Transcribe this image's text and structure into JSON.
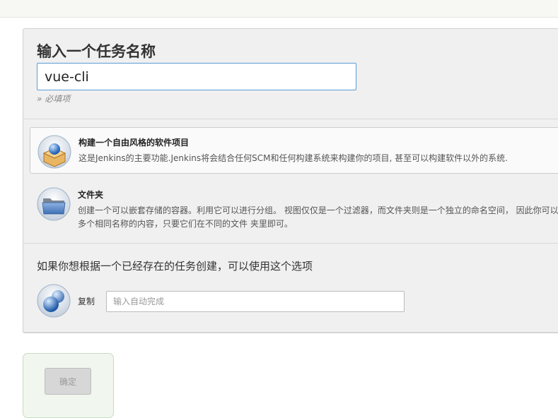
{
  "form": {
    "name_title": "输入一个任务名称",
    "name_value": "vue-cli",
    "required_note": "» 必填项"
  },
  "item_types": [
    {
      "label": "构建一个自由风格的软件项目",
      "description": "这是Jenkins的主要功能.Jenkins将会结合任何SCM和任何构建系统来构建你的项目, 甚至可以构建软件以外的系统.",
      "icon": "freestyle-project-icon",
      "selected": true
    },
    {
      "label": "文件夹",
      "description": "创建一个可以嵌套存储的容器。利用它可以进行分组。 视图仅仅是一个过滤器，而文件夹则是一个独立的命名空间， 因此你可以有多个相同名称的内容，只要它们在不同的文件 夹里即可。",
      "icon": "folder-icon",
      "selected": false
    }
  ],
  "copy": {
    "hint": "如果你想根据一个已经存在的任务创建，可以使用这个选项",
    "label": "复制",
    "placeholder": "输入自动完成",
    "icon": "copy-icon"
  },
  "footer": {
    "ok_label": "确定",
    "ok_enabled": false
  },
  "colors": {
    "input_focus_border": "#5b9bd5",
    "footer_background": "#f1f7ef"
  }
}
